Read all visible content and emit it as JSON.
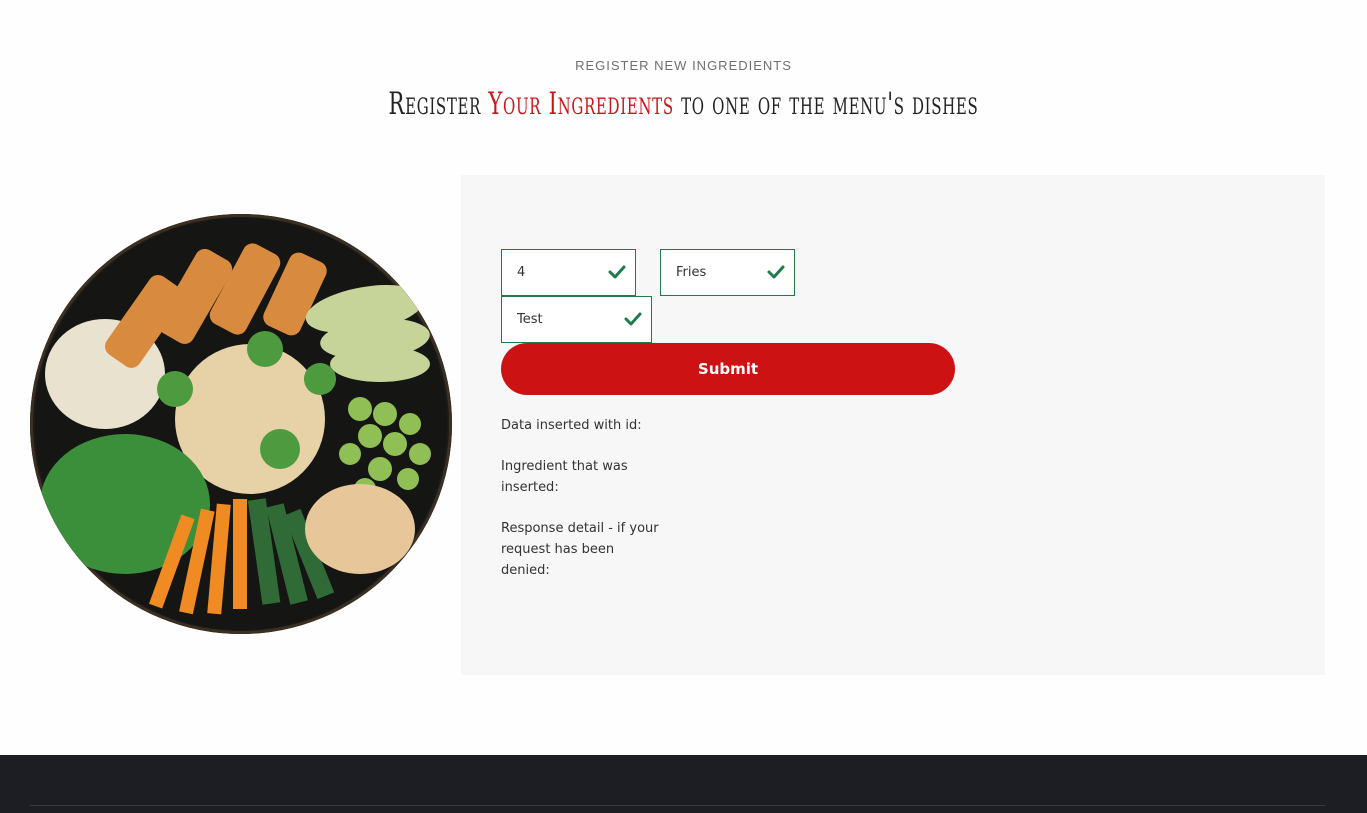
{
  "header": {
    "eyebrow": "REGISTER NEW INGREDIENTS",
    "title_part1": "Register ",
    "title_accent": "Your Ingredients",
    "title_part2": " to one of the menu's dishes",
    "accent_color": "#c8161b"
  },
  "form": {
    "field_id_value": "4",
    "field_dish_value": "Fries",
    "field_ingredient_value": "Test",
    "submit_label": "Submit",
    "valid_color": "#1f7a4c",
    "button_color": "#cc1212"
  },
  "results": {
    "inserted_id_label": "Data inserted with id:",
    "ingredient_label": "Ingredient that was inserted:",
    "response_label": "Response detail - if your request has been denied:"
  },
  "image": {
    "icon": "food-bowl-image"
  }
}
